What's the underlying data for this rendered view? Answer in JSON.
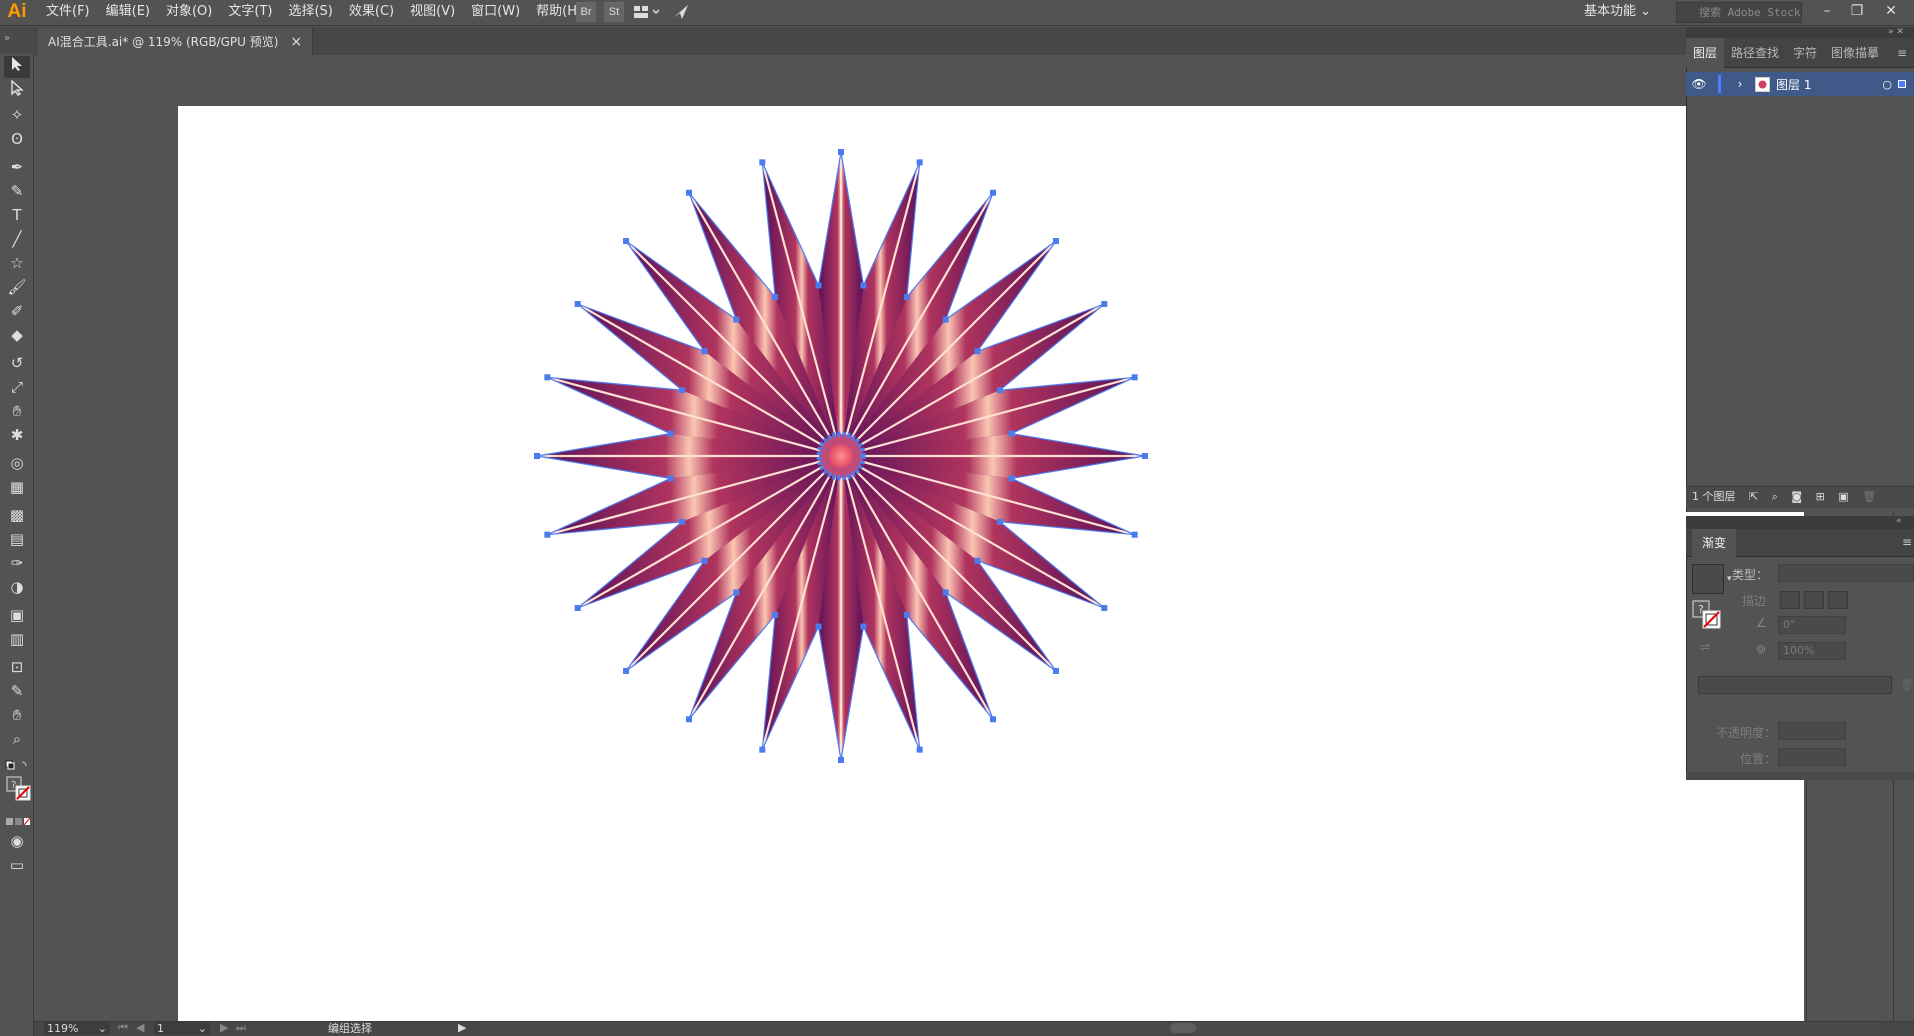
{
  "app": {
    "logo": "Ai"
  },
  "menu": [
    "文件(F)",
    "编辑(E)",
    "对象(O)",
    "文字(T)",
    "选择(S)",
    "效果(C)",
    "视图(V)",
    "窗口(W)",
    "帮助(H)"
  ],
  "menu_icons": {
    "bridge": "Br",
    "stock": "St",
    "arrange": "arrange-documents-icon",
    "sync": "sync-icon"
  },
  "workspace": {
    "label": "基本功能"
  },
  "stock_search": {
    "placeholder": "搜索 Adobe Stock"
  },
  "window_controls": {
    "minimize": "–",
    "restore": "❐",
    "close": "✕"
  },
  "document_tab": {
    "title": "AI混合工具.ai* @ 119% (RGB/GPU 预览)",
    "close": "×"
  },
  "tools": [
    "selection-tool",
    "direct-selection-tool",
    "magic-wand-tool",
    "lasso-tool",
    "pen-tool",
    "curvature-tool",
    "type-tool",
    "line-tool",
    "star-tool",
    "paintbrush-tool",
    "shaper-tool",
    "eraser-tool",
    "rotate-tool",
    "scale-tool",
    "warp-tool",
    "puppet-warp-tool",
    "shape-builder-tool",
    "perspective-grid-tool",
    "mesh-tool",
    "gradient-tool",
    "eyedropper-tool",
    "blend-tool",
    "symbol-sprayer-tool",
    "column-graph-tool",
    "artboard-tool",
    "slice-tool",
    "hand-tool",
    "zoom-tool"
  ],
  "status": {
    "zoom": "119%",
    "page": "1",
    "tool_name": "编组选择"
  },
  "layers_panel": {
    "tabs": [
      "图层",
      "路径查找",
      "字符",
      "图像描摹"
    ],
    "layer_name": "图层 1",
    "footer": "1 个图层"
  },
  "gradient_panel": {
    "title": "渐变",
    "type_label": "类型：",
    "stroke_label": "描边",
    "angle_value": "0°",
    "aspect_value": "100%",
    "opacity_label": "不透明度：",
    "position_label": "位置："
  },
  "colors": {
    "ui_bg": "#535353",
    "accent_selection": "#3f5a88",
    "logo": "#ff9a00",
    "ray_light": "#fbc6b2",
    "ray_dark": "#5a1158",
    "center": "#e85b70",
    "anchor": "#4a7cf0"
  }
}
